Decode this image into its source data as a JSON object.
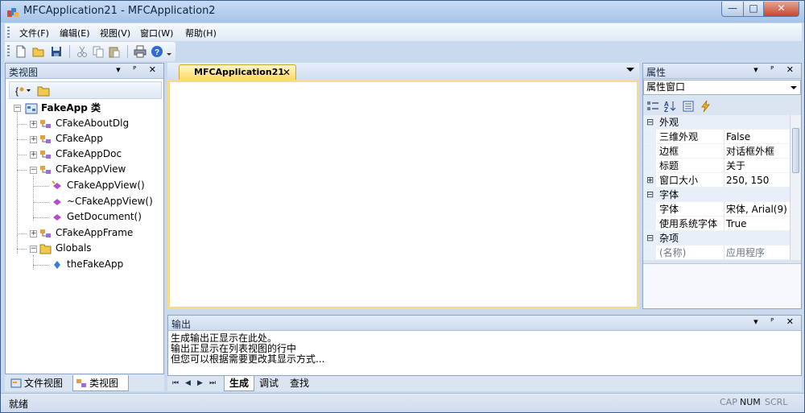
{
  "window": {
    "title": "MFCApplication21 - MFCApplication2",
    "controls": {
      "minimize": "—",
      "maximize": "□",
      "close": "✕"
    }
  },
  "menu": [
    "文件(F)",
    "编辑(E)",
    "视图(V)",
    "窗口(W)",
    "帮助(H)"
  ],
  "toolbar": [
    "new-file-icon",
    "open-folder-icon",
    "save-icon",
    "cut-icon",
    "copy-icon",
    "paste-icon",
    "print-icon",
    "help-icon"
  ],
  "class_view": {
    "title": "类视图",
    "pane_controls": "▾ ᴾ ✕",
    "tree": {
      "root": "FakeApp 类",
      "items": [
        "CFakeAboutDlg",
        "CFakeApp",
        "CFakeAppDoc",
        "CFakeAppView",
        "CFakeAppView()",
        "~CFakeAppView()",
        "GetDocument()",
        "CFakeAppFrame",
        "Globals",
        "theFakeApp"
      ]
    },
    "tabs": [
      "文件视图",
      "类视图"
    ]
  },
  "document": {
    "tab_label": "MFCApplication21",
    "tab_close": "✕"
  },
  "properties": {
    "title": "属性",
    "combo_value": "属性窗口",
    "categories": [
      {
        "name": "外观",
        "toggle": "⊟"
      },
      {
        "name": "字体",
        "toggle": "⊟"
      },
      {
        "name": "杂项",
        "toggle": "⊟"
      }
    ],
    "rows": [
      {
        "name": "三维外观",
        "value": "False"
      },
      {
        "name": "边框",
        "value": "对话框外框"
      },
      {
        "name": "标题",
        "value": "关于"
      },
      {
        "name": "窗口大小",
        "value": "250, 150",
        "toggle": "⊞"
      },
      {
        "name": "字体",
        "value": "宋体, Arial(9)"
      },
      {
        "name": "使用系统字体",
        "value": "True"
      },
      {
        "name": "(名称)",
        "value": "应用程序"
      }
    ]
  },
  "output": {
    "title": "输出",
    "lines": [
      "生成输出正显示在此处。",
      "输出正显示在列表视图的行中",
      "但您可以根据需要更改其显示方式..."
    ],
    "tabs": [
      "生成",
      "调试",
      "查找"
    ],
    "nav": [
      "⏮",
      "◀",
      "▶",
      "⏭"
    ]
  },
  "status": {
    "text": "就绪",
    "indicators": [
      "CAP",
      "NUM",
      "SCRL"
    ]
  }
}
